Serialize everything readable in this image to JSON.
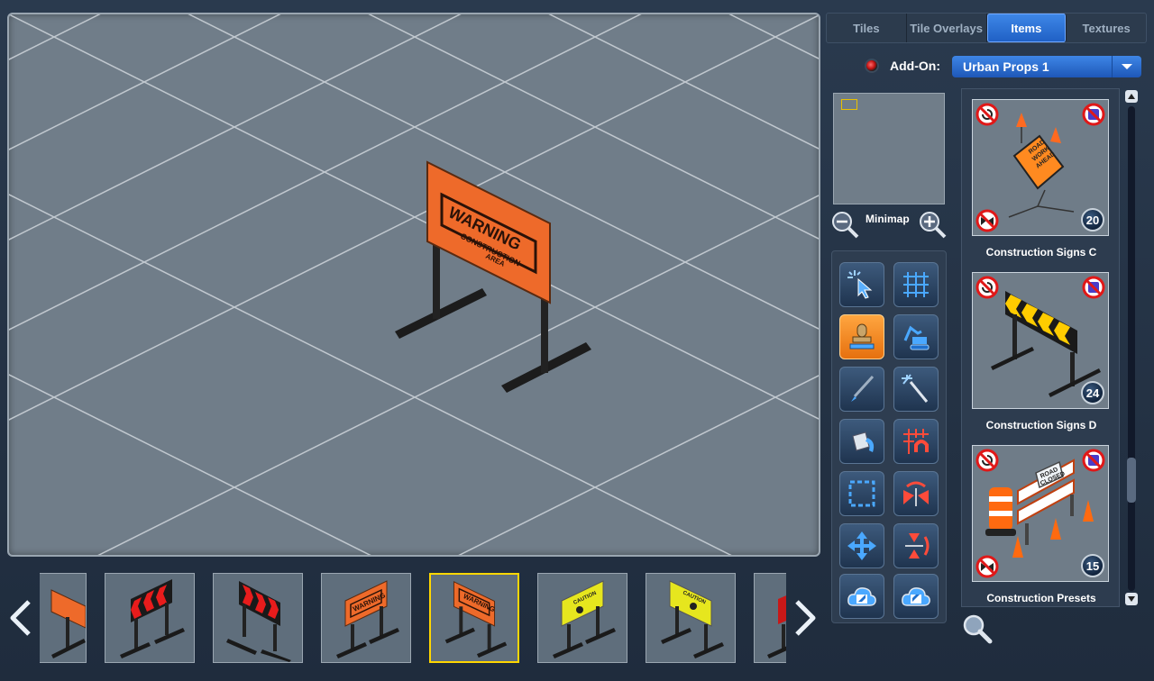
{
  "tabs": [
    {
      "label": "Tiles",
      "active": false
    },
    {
      "label": "Tile Overlays",
      "active": false
    },
    {
      "label": "Items",
      "active": true
    },
    {
      "label": "Textures",
      "active": false
    }
  ],
  "addon": {
    "label": "Add-On:",
    "selected": "Urban Props 1"
  },
  "minimap": {
    "label": "Minimap"
  },
  "canvas": {
    "sign_text": "WARNING",
    "sign_subtext": "CONSTRUCTION",
    "sign_subtext2": "AREA"
  },
  "items": [
    {
      "label": "Construction Signs C",
      "count": "20",
      "sign_lines": [
        "ROAD",
        "WORK",
        "AHEAD"
      ]
    },
    {
      "label": "Construction Signs D",
      "count": "24"
    },
    {
      "label": "Construction Presets",
      "count": "15",
      "sign_lines": [
        "ROAD",
        "CLOSED"
      ]
    }
  ],
  "filmstrip": {
    "selected_index": 4,
    "thumbs": [
      {
        "kind": "orange-partial"
      },
      {
        "kind": "red-chevron"
      },
      {
        "kind": "red-chevron"
      },
      {
        "kind": "orange-warning",
        "text": "WARNING"
      },
      {
        "kind": "orange-warning",
        "text": "WARNING"
      },
      {
        "kind": "yellow-caution",
        "text": "CAUTION"
      },
      {
        "kind": "yellow-caution",
        "text": "CAUTION"
      },
      {
        "kind": "red-partial"
      }
    ]
  },
  "colors": {
    "accent": "#2a6fd8",
    "active_tool": "#f08a24",
    "selection": "#ffd700"
  }
}
